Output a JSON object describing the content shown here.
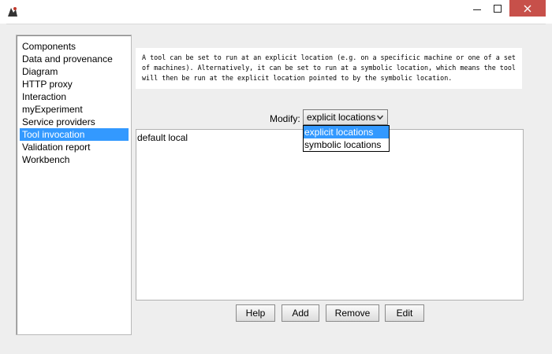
{
  "titlebar": {
    "icons": {
      "app": "app-logo-icon",
      "minimize": "minimize-icon",
      "maximize": "maximize-icon",
      "close": "close-icon"
    },
    "close_color": "#c7504a"
  },
  "sidebar": {
    "items": [
      {
        "label": "Components"
      },
      {
        "label": "Data and provenance"
      },
      {
        "label": "Diagram"
      },
      {
        "label": "HTTP proxy"
      },
      {
        "label": "Interaction"
      },
      {
        "label": "myExperiment"
      },
      {
        "label": "Service providers"
      },
      {
        "label": "Tool invocation"
      },
      {
        "label": "Validation report"
      },
      {
        "label": "Workbench"
      }
    ],
    "selected": "Tool invocation",
    "selection_color": "#3399ff"
  },
  "description": {
    "text": "A tool can be set to run at an explicit location (e.g. on a specificic machine or one of a set of machines). Alternatively, it can be set to run at a symbolic location, which means the tool will then be run at the explicit location pointed to by the symbolic location."
  },
  "modify": {
    "label": "Modify:",
    "selected_value": "explicit locations",
    "options": [
      "explicit locations",
      "symbolic locations"
    ]
  },
  "locations_list": {
    "items": [
      "default local"
    ]
  },
  "buttons": {
    "help": "Help",
    "add": "Add",
    "remove": "Remove",
    "edit": "Edit"
  }
}
